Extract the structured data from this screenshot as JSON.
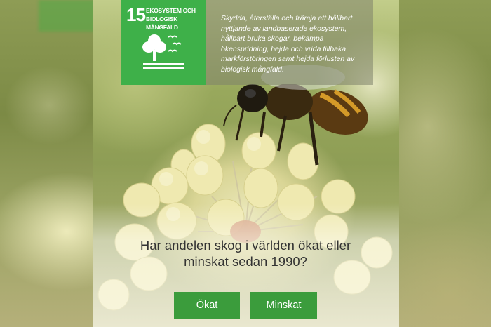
{
  "sdg": {
    "number": "15",
    "title_line1": "EKOSYSTEM OCH",
    "title_line2": "BIOLOGISK MÅNGFALD",
    "icon": "tree-and-birds-icon",
    "color": "#3eb049",
    "description": "Skydda, återställa och främja ett hållbart nyttjande av landbaserade ekosystem, hållbart bruka skogar, bekämpa ökenspridning, hejda och vrida tillbaka markförstöringen samt hejda förlusten av biologisk mångfald."
  },
  "quiz": {
    "question": "Har andelen skog i världen ökat eller minskat sedan 1990?",
    "answers": {
      "increase_label": "Ökat",
      "decrease_label": "Minskat"
    },
    "button_color": "#3b9c3c"
  }
}
